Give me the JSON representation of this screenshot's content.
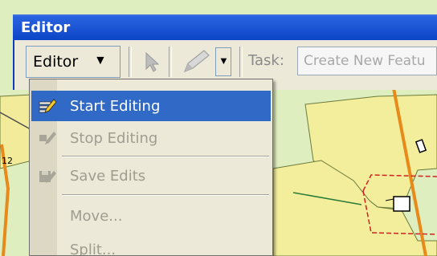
{
  "window": {
    "title": "Editor"
  },
  "toolbar": {
    "editor_menu_label": "Editor",
    "editor_menu_arrow": "▼",
    "sketch_dropdown_arrow": "▼",
    "task_label": "Task:",
    "task_value": "Create New Featu"
  },
  "menu": {
    "items": [
      {
        "label": "Start Editing",
        "icon": "start-editing-icon",
        "state": "highlighted"
      },
      {
        "label": "Stop Editing",
        "icon": "stop-editing-icon",
        "state": "disabled"
      },
      {
        "label": "Save Edits",
        "icon": "save-edits-icon",
        "state": "disabled"
      },
      {
        "label": "Move...",
        "icon": "",
        "state": "disabled"
      },
      {
        "label": "Split...",
        "icon": "",
        "state": "disabled"
      }
    ]
  },
  "map": {
    "label": "12"
  },
  "colors": {
    "title_bar": "#0b46c8",
    "menu_highlight": "#3169c6",
    "menu_background": "#ece9d8",
    "map_background": "#e8f0c8",
    "map_parcel": "#f3ee9c",
    "map_road": "#e88a1a",
    "selection_outline": "#d02020"
  }
}
